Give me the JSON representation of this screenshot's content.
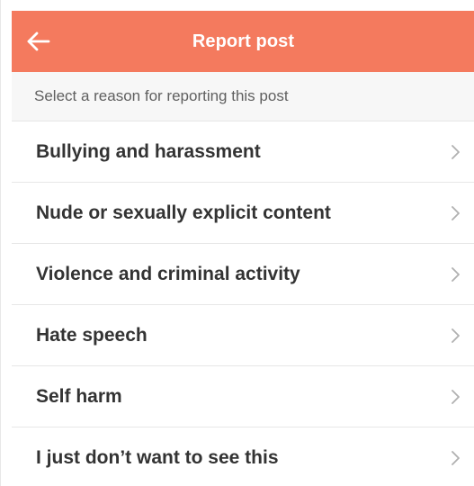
{
  "header": {
    "title": "Report post",
    "back_icon": "arrow-left-icon",
    "background_color": "#F47A5E"
  },
  "prompt": {
    "text": "Select a reason for reporting this post"
  },
  "reasons": [
    {
      "label": "Bullying and harassment",
      "icon": "chevron-right-icon"
    },
    {
      "label": "Nude or sexually explicit content",
      "icon": "chevron-right-icon"
    },
    {
      "label": "Violence and criminal activity",
      "icon": "chevron-right-icon"
    },
    {
      "label": "Hate speech",
      "icon": "chevron-right-icon"
    },
    {
      "label": "Self harm",
      "icon": "chevron-right-icon"
    },
    {
      "label": "I just don’t want to see this",
      "icon": "chevron-right-icon"
    }
  ]
}
